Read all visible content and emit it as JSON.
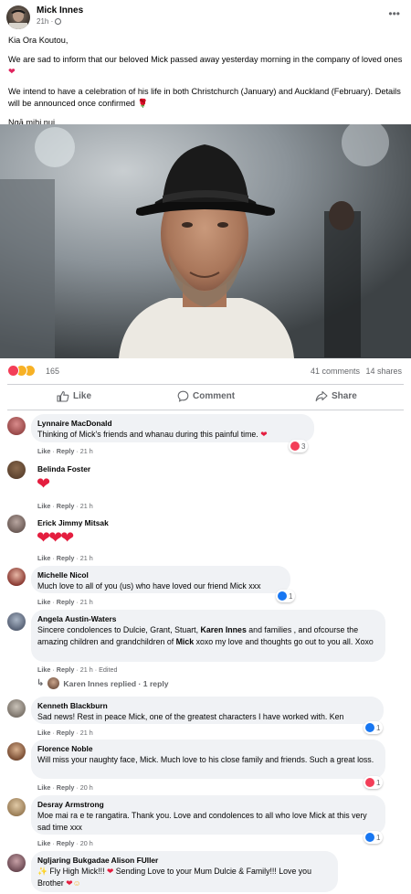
{
  "post": {
    "author": "Mick Innes",
    "time": "21h",
    "more": "•••",
    "paragraphs": [
      "Kia Ora Koutou,",
      "We are sad to inform that our beloved Mick passed away yesterday morning in the company of loved ones",
      "We intend to have a celebration of his life in both Christchurch (January) and Auckland (February). Details will be announced once confirmed",
      "Ngā mihi nui"
    ],
    "reactions_count": "165",
    "comments_count": "41 comments",
    "shares_count": "14 shares",
    "colors": {
      "love": "#f33e58",
      "like": "#1877f2",
      "sad": "#f7b125"
    }
  },
  "actions": {
    "like": "Like",
    "comment": "Comment",
    "share": "Share"
  },
  "comments": [
    {
      "name": "Lynnaire MacDonald",
      "text": "Thinking of Mick's friends and whanau during this painful time.",
      "like": "Like",
      "reply": "Reply",
      "time": "21 h",
      "reaction_count": "3"
    },
    {
      "name": "Belinda Foster",
      "hearts": "❤",
      "like": "Like",
      "reply": "Reply",
      "time": "21 h"
    },
    {
      "name": "Erick Jimmy Mitsak",
      "hearts": "❤❤❤",
      "like": "Like",
      "reply": "Reply",
      "time": "21 h"
    },
    {
      "name": "Michelle Nicol",
      "text": "Much love to all of you (us) who have loved our friend Mick xxx",
      "like": "Like",
      "reply": "Reply",
      "time": "21 h",
      "reaction_count": "1"
    },
    {
      "name": "Angela Austin-Waters",
      "text_a": "Sincere condolences to Dulcie, Grant, Stuart, ",
      "text_b": "Karen Innes",
      "text_c": " and families , and ofcourse the amazing children and grandchildren of ",
      "text_d": "Mick",
      "text_e": " xoxo my love and thoughts go out to you all. Xoxo",
      "like": "Like",
      "reply": "Reply",
      "time": "21 h",
      "edited": "Edited",
      "replied": "Karen Innes replied · 1 reply"
    },
    {
      "name": "Kenneth Blackburn",
      "text": "Sad news! Rest in peace Mick, one of the greatest characters I have worked with. Ken",
      "like": "Like",
      "reply": "Reply",
      "time": "21 h",
      "reaction_count": "1"
    },
    {
      "name": "Florence Noble",
      "text": "Will miss your naughty face, Mick. Much love to his close family and friends. Such a great loss.",
      "like": "Like",
      "reply": "Reply",
      "time": "20 h",
      "reaction_count": "1"
    },
    {
      "name": "Desray Armstrong",
      "text": "Moe mai ra e te rangatira. Thank you. Love and condolences to all who love Mick at this very sad time xxx",
      "like": "Like",
      "reply": "Reply",
      "time": "20 h",
      "reaction_count": "1"
    },
    {
      "name": "Ngljaring Bukgadae Alison FUller",
      "text_a": " Fly High Mick!!! ",
      "text_b": " Sending Love to your Mum Dulcie & Family!!! Love you Brother "
    }
  ]
}
